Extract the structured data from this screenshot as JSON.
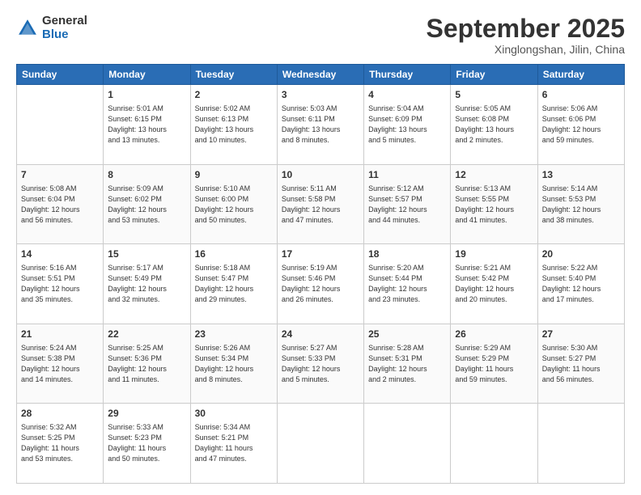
{
  "logo": {
    "general": "General",
    "blue": "Blue"
  },
  "header": {
    "month": "September 2025",
    "location": "Xinglongshan, Jilin, China"
  },
  "weekdays": [
    "Sunday",
    "Monday",
    "Tuesday",
    "Wednesday",
    "Thursday",
    "Friday",
    "Saturday"
  ],
  "weeks": [
    [
      {
        "day": "",
        "info": ""
      },
      {
        "day": "1",
        "info": "Sunrise: 5:01 AM\nSunset: 6:15 PM\nDaylight: 13 hours\nand 13 minutes."
      },
      {
        "day": "2",
        "info": "Sunrise: 5:02 AM\nSunset: 6:13 PM\nDaylight: 13 hours\nand 10 minutes."
      },
      {
        "day": "3",
        "info": "Sunrise: 5:03 AM\nSunset: 6:11 PM\nDaylight: 13 hours\nand 8 minutes."
      },
      {
        "day": "4",
        "info": "Sunrise: 5:04 AM\nSunset: 6:09 PM\nDaylight: 13 hours\nand 5 minutes."
      },
      {
        "day": "5",
        "info": "Sunrise: 5:05 AM\nSunset: 6:08 PM\nDaylight: 13 hours\nand 2 minutes."
      },
      {
        "day": "6",
        "info": "Sunrise: 5:06 AM\nSunset: 6:06 PM\nDaylight: 12 hours\nand 59 minutes."
      }
    ],
    [
      {
        "day": "7",
        "info": "Sunrise: 5:08 AM\nSunset: 6:04 PM\nDaylight: 12 hours\nand 56 minutes."
      },
      {
        "day": "8",
        "info": "Sunrise: 5:09 AM\nSunset: 6:02 PM\nDaylight: 12 hours\nand 53 minutes."
      },
      {
        "day": "9",
        "info": "Sunrise: 5:10 AM\nSunset: 6:00 PM\nDaylight: 12 hours\nand 50 minutes."
      },
      {
        "day": "10",
        "info": "Sunrise: 5:11 AM\nSunset: 5:58 PM\nDaylight: 12 hours\nand 47 minutes."
      },
      {
        "day": "11",
        "info": "Sunrise: 5:12 AM\nSunset: 5:57 PM\nDaylight: 12 hours\nand 44 minutes."
      },
      {
        "day": "12",
        "info": "Sunrise: 5:13 AM\nSunset: 5:55 PM\nDaylight: 12 hours\nand 41 minutes."
      },
      {
        "day": "13",
        "info": "Sunrise: 5:14 AM\nSunset: 5:53 PM\nDaylight: 12 hours\nand 38 minutes."
      }
    ],
    [
      {
        "day": "14",
        "info": "Sunrise: 5:16 AM\nSunset: 5:51 PM\nDaylight: 12 hours\nand 35 minutes."
      },
      {
        "day": "15",
        "info": "Sunrise: 5:17 AM\nSunset: 5:49 PM\nDaylight: 12 hours\nand 32 minutes."
      },
      {
        "day": "16",
        "info": "Sunrise: 5:18 AM\nSunset: 5:47 PM\nDaylight: 12 hours\nand 29 minutes."
      },
      {
        "day": "17",
        "info": "Sunrise: 5:19 AM\nSunset: 5:46 PM\nDaylight: 12 hours\nand 26 minutes."
      },
      {
        "day": "18",
        "info": "Sunrise: 5:20 AM\nSunset: 5:44 PM\nDaylight: 12 hours\nand 23 minutes."
      },
      {
        "day": "19",
        "info": "Sunrise: 5:21 AM\nSunset: 5:42 PM\nDaylight: 12 hours\nand 20 minutes."
      },
      {
        "day": "20",
        "info": "Sunrise: 5:22 AM\nSunset: 5:40 PM\nDaylight: 12 hours\nand 17 minutes."
      }
    ],
    [
      {
        "day": "21",
        "info": "Sunrise: 5:24 AM\nSunset: 5:38 PM\nDaylight: 12 hours\nand 14 minutes."
      },
      {
        "day": "22",
        "info": "Sunrise: 5:25 AM\nSunset: 5:36 PM\nDaylight: 12 hours\nand 11 minutes."
      },
      {
        "day": "23",
        "info": "Sunrise: 5:26 AM\nSunset: 5:34 PM\nDaylight: 12 hours\nand 8 minutes."
      },
      {
        "day": "24",
        "info": "Sunrise: 5:27 AM\nSunset: 5:33 PM\nDaylight: 12 hours\nand 5 minutes."
      },
      {
        "day": "25",
        "info": "Sunrise: 5:28 AM\nSunset: 5:31 PM\nDaylight: 12 hours\nand 2 minutes."
      },
      {
        "day": "26",
        "info": "Sunrise: 5:29 AM\nSunset: 5:29 PM\nDaylight: 11 hours\nand 59 minutes."
      },
      {
        "day": "27",
        "info": "Sunrise: 5:30 AM\nSunset: 5:27 PM\nDaylight: 11 hours\nand 56 minutes."
      }
    ],
    [
      {
        "day": "28",
        "info": "Sunrise: 5:32 AM\nSunset: 5:25 PM\nDaylight: 11 hours\nand 53 minutes."
      },
      {
        "day": "29",
        "info": "Sunrise: 5:33 AM\nSunset: 5:23 PM\nDaylight: 11 hours\nand 50 minutes."
      },
      {
        "day": "30",
        "info": "Sunrise: 5:34 AM\nSunset: 5:21 PM\nDaylight: 11 hours\nand 47 minutes."
      },
      {
        "day": "",
        "info": ""
      },
      {
        "day": "",
        "info": ""
      },
      {
        "day": "",
        "info": ""
      },
      {
        "day": "",
        "info": ""
      }
    ]
  ]
}
